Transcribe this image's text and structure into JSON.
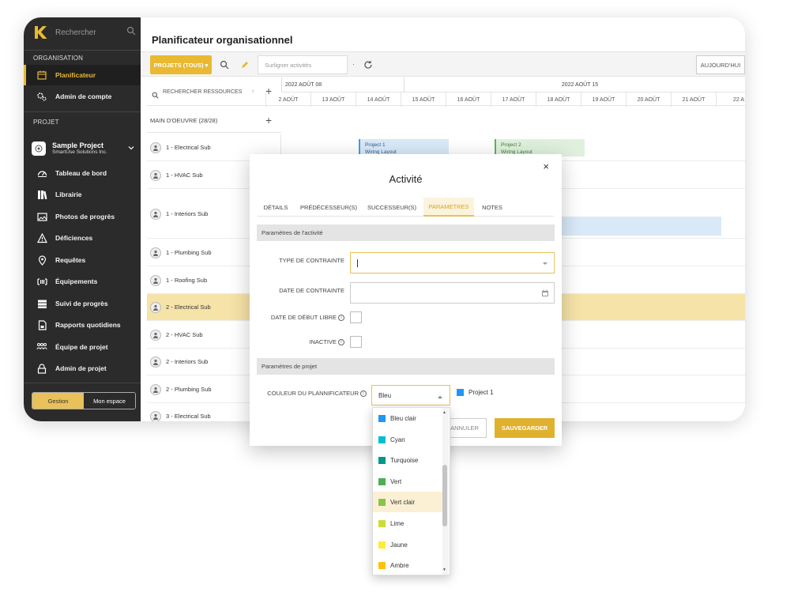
{
  "sidebar": {
    "search_placeholder": "Rechercher",
    "section_org": "ORGANISATION",
    "org_items": [
      {
        "label": "Planificateur",
        "icon": "calendar-icon"
      },
      {
        "label": "Admin de compte",
        "icon": "gears-icon"
      }
    ],
    "section_project": "PROJET",
    "project": {
      "name": "Sample Project",
      "company": "SmartUse Solutions Inc."
    },
    "project_items": [
      {
        "label": "Tableau de bord",
        "icon": "dashboard-icon"
      },
      {
        "label": "Librairie",
        "icon": "library-icon"
      },
      {
        "label": "Photos de progrès",
        "icon": "photos-icon"
      },
      {
        "label": "Déficiences",
        "icon": "warning-icon"
      },
      {
        "label": "Requêtes",
        "icon": "location-pin-icon"
      },
      {
        "label": "Équipements",
        "icon": "equipment-icon"
      },
      {
        "label": "Suivi de progrès",
        "icon": "progress-icon"
      },
      {
        "label": "Rapports quotidiens",
        "icon": "report-icon"
      },
      {
        "label": "Équipe de projet",
        "icon": "team-icon"
      },
      {
        "label": "Admin de projet",
        "icon": "lock-icon"
      }
    ],
    "toggle": {
      "left": "Gestion",
      "right": "Mon espace"
    }
  },
  "main": {
    "title": "Planificateur organisationnel",
    "toolbar": {
      "projects_button": "PROJETS (TOUS) ▾",
      "highlight_placeholder": "Surligner activités",
      "dot": "·",
      "today_button": "AUJOURD'HUI"
    },
    "resources": {
      "search_label": "RECHERCHER RESSOURCES",
      "sort": "↑",
      "add": "+",
      "group_label": "MAIN D'OEUVRE (28/28)",
      "group_add": "+"
    },
    "weeks": [
      "2022 AOÛT 08",
      "2022 AOÛT 15"
    ],
    "days": [
      "2 AOÛT",
      "13 AOÛT",
      "14 AOÛT",
      "15 AOÛT",
      "16 AOÛT",
      "17 AOÛT",
      "18 AOÛT",
      "19 AOÛT",
      "20 AOÛT",
      "21 AOÛT",
      "22 A"
    ],
    "rows": [
      {
        "label": "1 - Electrical Sub"
      },
      {
        "label": "1 - HVAC Sub"
      },
      {
        "label": "1 - Interiors Sub"
      },
      {
        "label": "1 - Plumbing Sub"
      },
      {
        "label": "1 - Roofing Sub"
      },
      {
        "label": "2 - Electrical Sub"
      },
      {
        "label": "2 - HVAC Sub"
      },
      {
        "label": "2 - Interiors Sub"
      },
      {
        "label": "2 - Plumbing Sub"
      },
      {
        "label": "3 - Electrical Sub"
      }
    ],
    "bars": [
      {
        "project": "Project 1",
        "activity": "Wiring Layout"
      },
      {
        "project": "Project 2",
        "activity": "Wiring Layout"
      }
    ]
  },
  "modal": {
    "close": "×",
    "title": "Activité",
    "tabs": [
      "DÉTAILS",
      "PRÉDÉCESSEUR(S)",
      "SUCCESSEUR(S)",
      "PARAMETRES",
      "NOTES"
    ],
    "active_tab": "PARAMETRES",
    "section_activity": "Paramètres de l'activité",
    "constraint_type_label": "TYPE DE CONTRAINTE",
    "constraint_date_label": "DATE DE CONTRAINTE",
    "free_start_label": "DATE DE DÉBUT LIBRE",
    "inactive_label": "INACTIVE",
    "section_project": "Paramètres de projet",
    "color_label": "COULEUR DU PLANNIFICATEUR",
    "color_value": "Bleu",
    "preview_label": "Project 1",
    "cancel_button": "ANNULER",
    "save_button": "SAUVEGARDER"
  },
  "dropdown": {
    "options": [
      {
        "label": "Bleu clair",
        "color": "#2196f3"
      },
      {
        "label": "Cyan",
        "color": "#00bcd4"
      },
      {
        "label": "Turquoise",
        "color": "#009688"
      },
      {
        "label": "Vert",
        "color": "#4caf50"
      },
      {
        "label": "Vert clair",
        "color": "#8bc34a"
      },
      {
        "label": "Lime",
        "color": "#cddc39"
      },
      {
        "label": "Jaune",
        "color": "#ffeb3b"
      },
      {
        "label": "Ambre",
        "color": "#ffc107"
      }
    ],
    "hovered": "Vert clair"
  },
  "colors": {
    "accent": "#e8b931",
    "sidebar_bg": "#2b2b2b",
    "selected_blue": "#2196f3"
  }
}
